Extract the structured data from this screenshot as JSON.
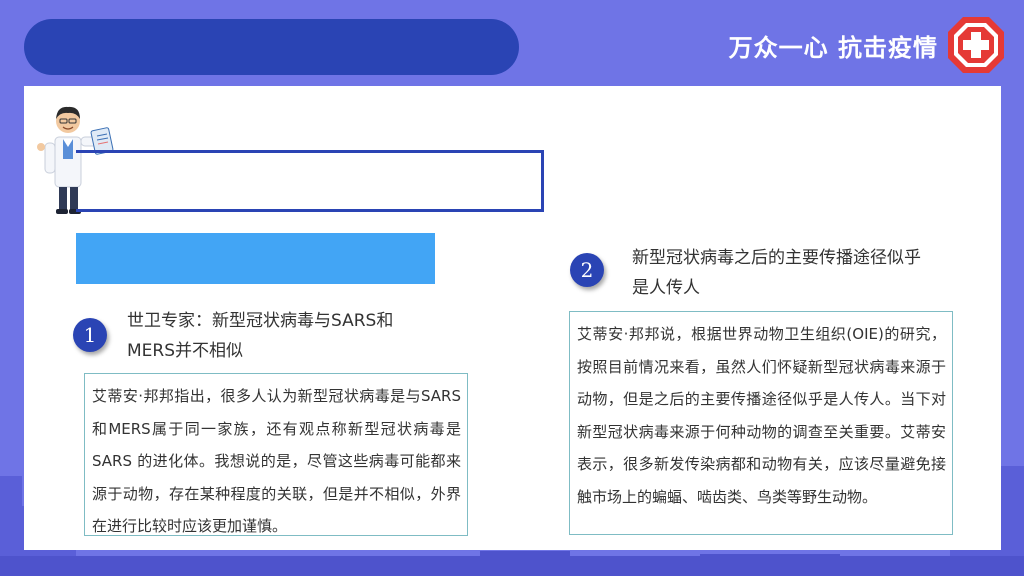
{
  "header": {
    "slogan": "万众一心 抗击疫情",
    "logo_icon": "red-cross-icon"
  },
  "illustration": {
    "icon": "doctor-with-clipboard-icon"
  },
  "sections": [
    {
      "number": "1",
      "heading": "世卫专家：新型冠状病毒与SARS和MERS并不相似",
      "body": "艾蒂安·邦邦指出，很多人认为新型冠状病毒是与SARS和MERS属于同一家族，还有观点称新型冠状病毒是SARS 的进化体。我想说的是，尽管这些病毒可能都来源于动物，存在某种程度的关联，但是并不相似，外界在进行比较时应该更加谨慎。"
    },
    {
      "number": "2",
      "heading": "新型冠状病毒之后的主要传播途径似乎是人传人",
      "body": "艾蒂安·邦邦说，根据世界动物卫生组织(OIE)的研究， 按照目前情况来看，虽然人们怀疑新型冠状病毒来源于动物，但是之后的主要传播途径似乎是人传人。当下对新型冠状病毒来源于何种动物的调查至关重要。艾蒂安表示，很多新发传染病都和动物有关，应该尽量避免接触市场上的蝙蝠、啮齿类、鸟类等野生动物。"
    }
  ],
  "colors": {
    "background": "#6f74e6",
    "primary_blue": "#2a44b4",
    "accent_blue": "#42a5f5",
    "cross_red": "#e53935",
    "box_border": "#7fbcc4"
  }
}
